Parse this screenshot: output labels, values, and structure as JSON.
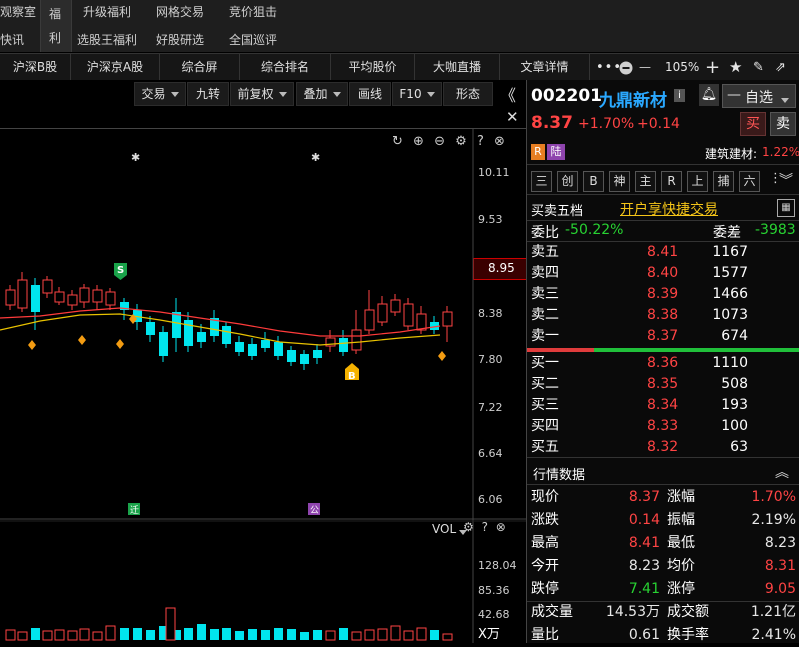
{
  "top_nav": {
    "row1": [
      "观察室",
      "升级福利",
      "网格交易",
      "竞价狙击"
    ],
    "row2": [
      "快讯",
      "选股王福利",
      "好股研选",
      "全国巡评"
    ],
    "fuli_top": "福",
    "fuli_bottom": "利"
  },
  "tabs": [
    "沪深B股",
    "沪深京A股",
    "综合屏",
    "综合排名",
    "平均股价",
    "大咖直播",
    "文章详情"
  ],
  "zoom": "105%",
  "chart_toolbar": [
    "交易",
    "九转",
    "前复权",
    "叠加",
    "画线",
    "F10",
    "形态"
  ],
  "y_axis_labels": [
    "10.11",
    "9.53",
    "8.95",
    "8.38",
    "7.80",
    "7.22",
    "6.64",
    "6.06"
  ],
  "current_price_tag": "8.95",
  "vol": {
    "label": "VOL",
    "ticks": [
      "128.04",
      "85.36",
      "42.68"
    ],
    "unit": "X万"
  },
  "markers": {
    "b_label": "B",
    "s_label": "S"
  },
  "stock": {
    "code": "002201",
    "name": "九鼎新材",
    "info_badge": "i",
    "price": "8.37",
    "change_pct": "+1.70%",
    "change_amt": "+0.14",
    "buy_btn": "买",
    "sell_btn": "卖",
    "self_select": "自选",
    "tag_r": "R",
    "tag_lu": "陆",
    "industry": "建筑建材:",
    "industry_change": "1.22%"
  },
  "quick_buttons": [
    "三",
    "创",
    "B",
    "神",
    "主",
    "R",
    "上",
    "捕",
    "六"
  ],
  "orderbook": {
    "title": "买卖五档",
    "quick_trade": "开户享快捷交易",
    "weibi_label": "委比",
    "weibi_value": "-50.22%",
    "weicha_label": "委差",
    "weicha_value": "-3983",
    "asks": [
      {
        "label": "卖五",
        "price": "8.41",
        "vol": "1167"
      },
      {
        "label": "卖四",
        "price": "8.40",
        "vol": "1577"
      },
      {
        "label": "卖三",
        "price": "8.39",
        "vol": "1466"
      },
      {
        "label": "卖二",
        "price": "8.38",
        "vol": "1073"
      },
      {
        "label": "卖一",
        "price": "8.37",
        "vol": "674"
      }
    ],
    "bids": [
      {
        "label": "买一",
        "price": "8.36",
        "vol": "1110"
      },
      {
        "label": "买二",
        "price": "8.35",
        "vol": "508"
      },
      {
        "label": "买三",
        "price": "8.34",
        "vol": "193"
      },
      {
        "label": "买四",
        "price": "8.33",
        "vol": "100"
      },
      {
        "label": "买五",
        "price": "8.32",
        "vol": "63"
      }
    ]
  },
  "market": {
    "title": "行情数据",
    "rows": [
      {
        "l1": "现价",
        "v1": "8.37",
        "c1": "red",
        "l2": "涨幅",
        "v2": "1.70%",
        "c2": "red"
      },
      {
        "l1": "涨跌",
        "v1": "0.14",
        "c1": "red",
        "l2": "振幅",
        "v2": "2.19%",
        "c2": "white"
      },
      {
        "l1": "最高",
        "v1": "8.41",
        "c1": "red",
        "l2": "最低",
        "v2": "8.23",
        "c2": "white"
      },
      {
        "l1": "今开",
        "v1": "8.23",
        "c1": "white",
        "l2": "均价",
        "v2": "8.31",
        "c2": "red"
      },
      {
        "l1": "跌停",
        "v1": "7.41",
        "c1": "green",
        "l2": "涨停",
        "v2": "9.05",
        "c2": "red"
      },
      {
        "l1": "成交量",
        "v1": "14.53万",
        "c1": "white",
        "l2": "成交额",
        "v2": "1.21亿",
        "c2": "white"
      },
      {
        "l1": "量比",
        "v1": "0.61",
        "c1": "white",
        "l2": "换手率",
        "v2": "2.41%",
        "c2": "white"
      }
    ]
  },
  "colors": {
    "up": "#ff4444",
    "down": "#00e5ee",
    "ma1": "#ff3b3b",
    "ma2": "#e8c200"
  }
}
